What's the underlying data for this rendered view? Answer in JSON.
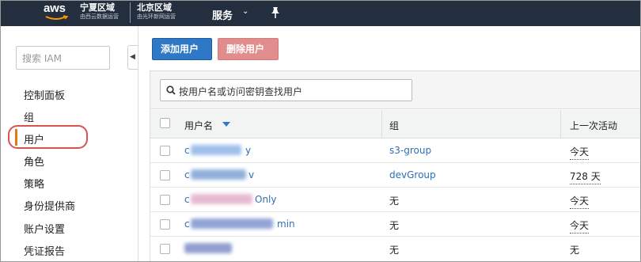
{
  "topnav": {
    "logo_text": "aws",
    "region1_name": "宁夏区域",
    "region1_operator": "由西云数据运营",
    "region2_name": "北京区域",
    "region2_operator": "由光环新网运营",
    "services_label": "服务",
    "services_chevron": "⌄"
  },
  "sidebar": {
    "search_placeholder": "搜索 IAM",
    "collapse_glyph": "◀",
    "items": [
      {
        "label": "控制面板"
      },
      {
        "label": "组"
      },
      {
        "label": "用户"
      },
      {
        "label": "角色"
      },
      {
        "label": "策略"
      },
      {
        "label": "身份提供商"
      },
      {
        "label": "账户设置"
      },
      {
        "label": "凭证报告"
      }
    ],
    "active_item": "用户",
    "accent_color": "#e47911",
    "highlight_color": "#d9534f"
  },
  "toolbar": {
    "add_user_label": "添加用户",
    "delete_user_label": "删除用户"
  },
  "table": {
    "search_placeholder": "按用户名或访问密钥查找用户",
    "columns": [
      "用户名",
      "组",
      "上一次活动"
    ],
    "rows": [
      {
        "username_start": "c",
        "username_end": "y",
        "group": "s3-group",
        "last_activity": "今天"
      },
      {
        "username_start": "c",
        "username_end": "v",
        "group": "devGroup",
        "last_activity": "728 天"
      },
      {
        "username_start": "c",
        "username_end": "Only",
        "group": "无",
        "last_activity": "今天"
      },
      {
        "username_start": "c",
        "username_end": "min",
        "group": "无",
        "last_activity": "今天"
      },
      {
        "username_start": "",
        "username_end": "",
        "group": "无",
        "last_activity": "无"
      }
    ]
  }
}
